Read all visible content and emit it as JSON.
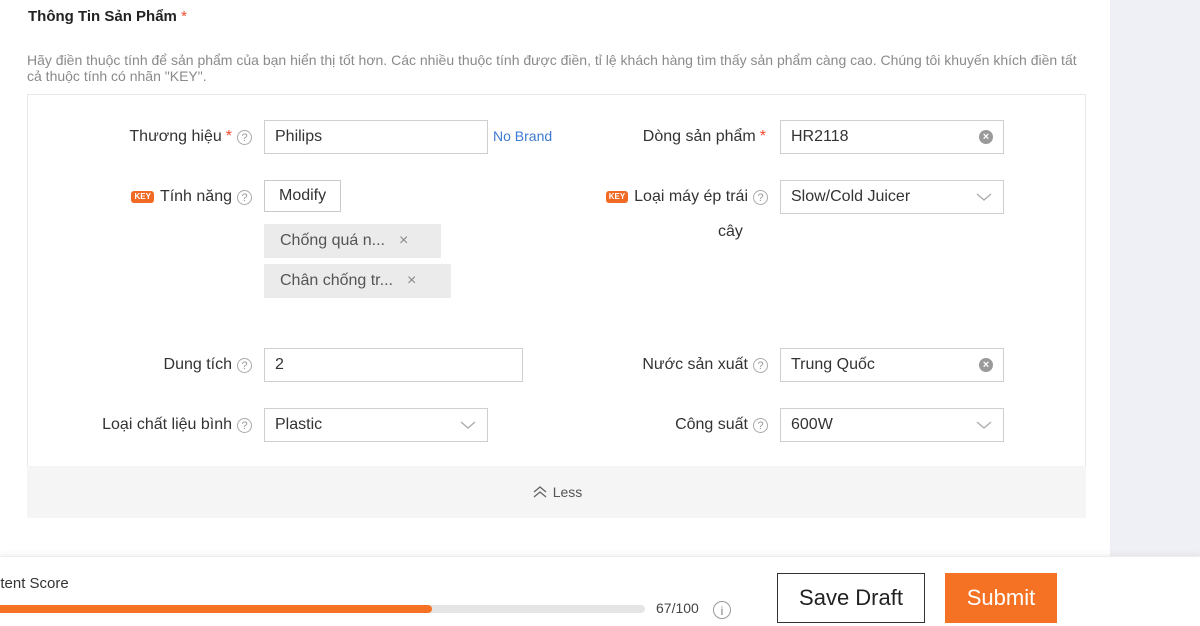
{
  "section": {
    "title": "Thông Tin Sản Phẩm",
    "required_mark": "*",
    "hint": "Hãy điền thuộc tính để sản phẩm của bạn hiển thị tốt hơn. Các nhiều thuộc tính được điền, tỉ lệ khách hàng tìm thấy sản phẩm càng cao. Chúng tôi khuyến khích điền tất cả thuộc tính có nhãn \"KEY\"."
  },
  "key_badge": "KEY",
  "help_glyph": "?",
  "fields": {
    "brand": {
      "label": "Thương hiệu",
      "value": "Philips",
      "link": "No Brand"
    },
    "model": {
      "label": "Dòng sản phẩm",
      "value": "HR2118"
    },
    "features": {
      "label": "Tính năng",
      "button": "Modify",
      "tags": [
        "Chống quá n...",
        "Chân chống tr..."
      ]
    },
    "juicer_type": {
      "label_line1": "Loại máy ép trái",
      "label_line2": "cây",
      "value": "Slow/Cold Juicer"
    },
    "capacity": {
      "label": "Dung tích",
      "value": "2"
    },
    "origin": {
      "label": "Nước sản xuất",
      "value": "Trung Quốc"
    },
    "jar_material": {
      "label": "Loại chất liệu bình",
      "value": "Plastic"
    },
    "power": {
      "label": "Công suất",
      "value": "600W"
    }
  },
  "less_toggle": {
    "label": "Less",
    "icon": "double-chevron-up-icon"
  },
  "footer": {
    "score_label": "ntent Score",
    "score_text": "67/100",
    "score_value": 67,
    "score_max": 100,
    "info_glyph": "i",
    "save_draft": "Save Draft",
    "submit": "Submit"
  },
  "colors": {
    "accent": "#f57224",
    "required": "#f04b2d",
    "link": "#3d7ad1",
    "key_badge": "#f06a24"
  }
}
